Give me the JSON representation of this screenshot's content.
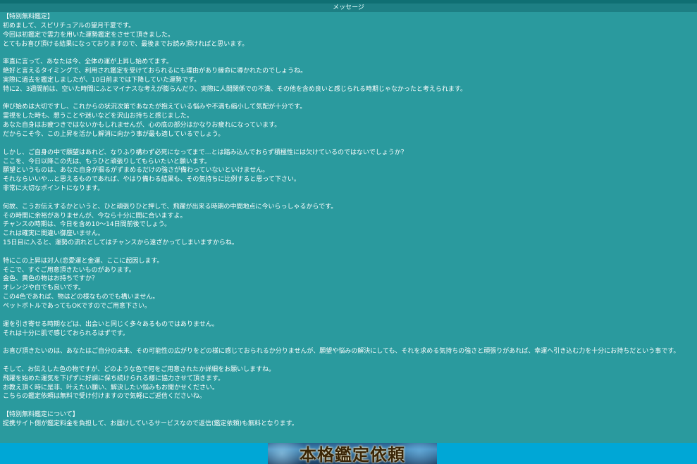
{
  "window": {
    "title": "メッセージ"
  },
  "message": {
    "lines": [
      "【特別無料鑑定】",
      "初めまして、スピリチュアルの望月千夏です。",
      "今回は初鑑定で霊力を用いた運勢鑑定をさせて頂きました。",
      "とてもお喜び頂ける結果になっておりますので、最後までお読み頂ければと思います。",
      "",
      "率直に言って、あなたは今、全体の運が上昇し始めてます。",
      "絶好と言えるタイミングで、利用され鑑定を受けておられるにも理由があり縁命に導かれたのでしょうね。",
      "実際に過去を鑑定しましたが、10日前までは下降していた運勢です。",
      "特に2、3週間前は、空いた時間にふとマイナスな考えが膨らんだり、実際に人間関係での不満、その他を含め良いと感じられる時期じゃなかったと考えられます。",
      "",
      "伸び始めは大切ですし、これからの状況次第であなたが抱えている悩みや不満も縮小して気配が十分です。",
      "霊視をした時も、想うことや迷いなどを沢山お持ちと感じました。",
      "あなた自身はお疲つきではないかもしれませんが、心の底の部分はかなりお疲れになっています。",
      "だからこそ今、この上昇を活かし解消に向かう事が最も適しているでしょう。",
      "",
      "しかし、ご自身の中で願望はあれど、なりふり構わず必死になってまで…とは踏み込んでおらず積極性には欠けているのではないでしょうか？",
      "ここを、今日以降この先は、もうひと頑張りしてもらいたいと願います。",
      "願望というものは、あなた自身が掴るがずまめるだけの強さが備わっていないといけません。",
      "それならいいや…と思えるものであれば、やはり備わる結果も、その気持ちに比例すると思って下さい。",
      "非常に大切なポイントになります。",
      "",
      "何故、こうお伝えするかというと、ひと頑張りひと押しで、飛躍が出来る時期の中間地点に今いらっしゃるからです。",
      "その時間に余裕がありませんが、今なら十分に間に合いますよ。",
      "チャンスの時期は、今日を含め10〜14日間前後でしょう。",
      "これは確実に間違い御座いません。",
      "15日目に入ると、運勢の流れとしてはチャンスから遠ざかってしまいますからね。",
      "",
      "特にこの上昇は対人(恋愛運と金運、ここに起因します。",
      "そこで、すぐご用意頂きたいものがあります。",
      "金色、黄色の物はお持ちですか？",
      "オレンジや白でも良いです。",
      "この4色であれば、物はどの様なものでも構いません。",
      "ペットボトルであってもOKですのでご用意下さい。",
      "",
      "運を引き寄せる時期などは、出会いと同じく多々あるものではありません。",
      "それは十分に肌で感じておられるはずです。",
      "",
      "お喜び頂きたいのは、あなたはご自分の未来、その可能性の広がりをどの様に感じておられるか分りませんが、願望や悩みの解決にしても、それを求める気持ちの強さと頑張りがあれば、幸運へ引き込む力を十分にお持ちだという事です。",
      "",
      "そして、お伝えした色の物ですが、どのような色で何をご用意されたか詳細をお願いしますね。",
      "飛躍を始めた運気を下げずに好調に保ち続けられる様に協力させて頂きます。",
      "お教え頂く時に是非、叶えたい願い、解決したい悩みもお聞かせください。",
      "こちらの鑑定依頼は無料で受け付けますので気軽にご返信くださいね。",
      "",
      "【特別無料鑑定について】",
      "提携サイト側が鑑定料金を負担して、お届けしているサービスなので返信(鑑定依頼)も無料となります。"
    ]
  },
  "banner": {
    "label": "本格鑑定依頼"
  },
  "colors": {
    "background": "#2a9a9e",
    "title_bar": "#1d7f84",
    "bottom_bar": "#00a7d6",
    "text": "#ffffff"
  }
}
